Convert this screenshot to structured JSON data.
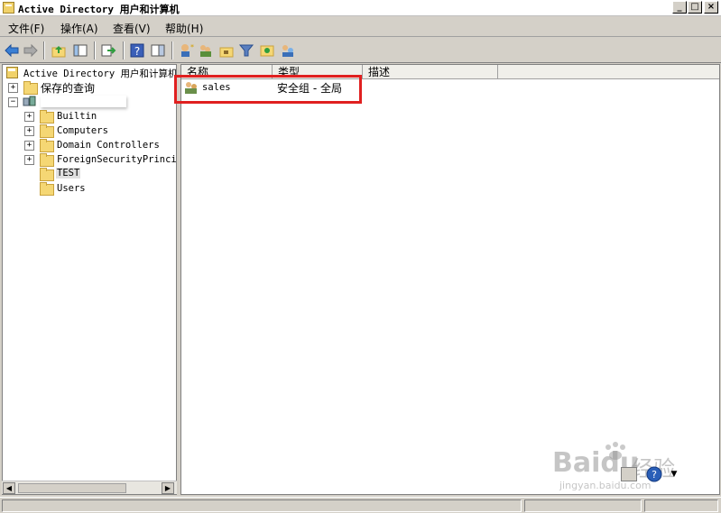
{
  "window": {
    "title": "Active Directory 用户和计算机",
    "controls": [
      "_",
      "□",
      "×"
    ]
  },
  "menubar": {
    "items": [
      "文件(F)",
      "操作(A)",
      "查看(V)",
      "帮助(H)"
    ]
  },
  "toolbar": {
    "icons": [
      "back-arrow-icon",
      "forward-arrow-icon",
      "up-folder-icon",
      "console-tree-icon",
      "export-list-icon",
      "help-icon",
      "show-hide-icon",
      "new-user-icon",
      "new-group-icon",
      "new-ou-icon",
      "filter-icon",
      "add-to-group-icon",
      "delegate-icon"
    ]
  },
  "tree": {
    "root_label": "Active Directory 用户和计算机",
    "saved_queries_label": "保存的查询",
    "domain_label": "",
    "children": [
      {
        "label": "Builtin",
        "expandable": true
      },
      {
        "label": "Computers",
        "expandable": true
      },
      {
        "label": "Domain Controllers",
        "expandable": true
      },
      {
        "label": "ForeignSecurityPrincip",
        "expandable": true
      },
      {
        "label": "TEST",
        "expandable": false,
        "selected": true
      },
      {
        "label": "Users",
        "expandable": false
      }
    ]
  },
  "list": {
    "columns": [
      "名称",
      "类型",
      "描述"
    ],
    "rows": [
      {
        "name": "sales",
        "type": "安全组 - 全局",
        "description": ""
      }
    ]
  },
  "watermark": {
    "brand": "Baidu",
    "sub": "经验",
    "url": "jingyan.baidu.com"
  },
  "colors": {
    "highlight_box": "#e02020",
    "selected_bg": "#e0e0e0"
  }
}
